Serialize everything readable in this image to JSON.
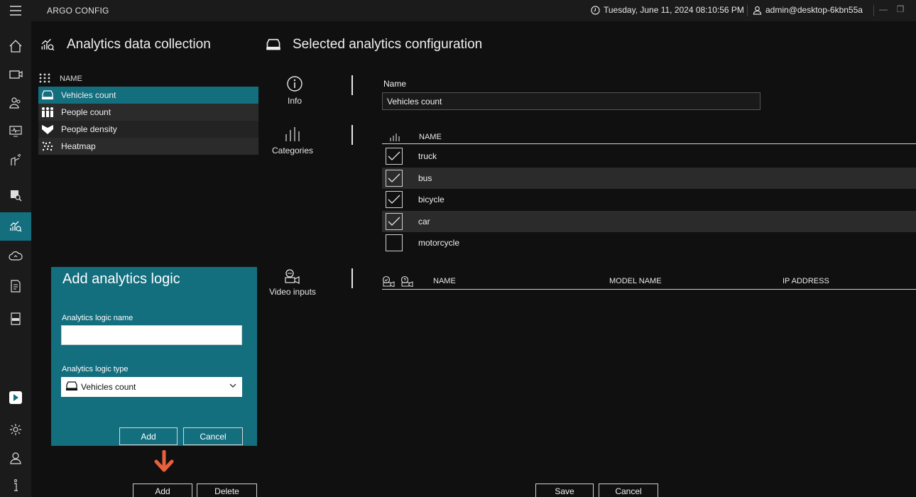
{
  "window": {
    "app_title": "ARGO CONFIG",
    "datetime": "Tuesday, June 11, 2024 08:10:56 PM",
    "user": "admin@desktop-6kbn55a",
    "minimize_glyph": "—",
    "restore_glyph": "❐"
  },
  "rail": {
    "items": [
      {
        "icon": "hamburger-menu-icon"
      },
      {
        "icon": "home-icon"
      },
      {
        "icon": "camera-config-icon"
      },
      {
        "icon": "users-icon"
      },
      {
        "icon": "monitor-icon"
      },
      {
        "icon": "sensor-icon"
      },
      {
        "icon": "search-person-icon"
      },
      {
        "icon": "analytics-icon",
        "active": true
      },
      {
        "icon": "cloud-sync-icon"
      },
      {
        "icon": "document-icon"
      },
      {
        "icon": "log-icon"
      },
      {
        "icon": "play-logo-icon"
      },
      {
        "icon": "settings-icon"
      },
      {
        "icon": "account-icon"
      },
      {
        "icon": "info-icon"
      }
    ]
  },
  "left_panel": {
    "title": "Analytics data collection",
    "column_name": "NAME",
    "items": [
      {
        "label": "Vehicles count",
        "icon": "vehicles-icon",
        "selected": true
      },
      {
        "label": "People count",
        "icon": "people-count-icon"
      },
      {
        "label": "People density",
        "icon": "people-density-icon"
      },
      {
        "label": "Heatmap",
        "icon": "heatmap-icon"
      }
    ],
    "add_button": "Add",
    "delete_button": "Delete"
  },
  "dialog": {
    "title": "Add analytics logic",
    "name_label": "Analytics logic name",
    "name_value": "",
    "type_label": "Analytics logic type",
    "type_value": "Vehicles count",
    "add_button": "Add",
    "cancel_button": "Cancel"
  },
  "right_panel": {
    "title": "Selected analytics configuration",
    "sections": {
      "info": "Info",
      "categories": "Categories",
      "video_inputs": "Video inputs"
    },
    "name_label": "Name",
    "name_value": "Vehicles count",
    "categories_column": "NAME",
    "categories": [
      {
        "label": "truck",
        "checked": true
      },
      {
        "label": "bus",
        "checked": true
      },
      {
        "label": "bicycle",
        "checked": true
      },
      {
        "label": "car",
        "checked": true
      },
      {
        "label": "motorcycle",
        "checked": false
      }
    ],
    "video_columns": {
      "name": "NAME",
      "model_name": "MODEL NAME",
      "ip_address": "IP ADDRESS"
    },
    "save_button": "Save",
    "cancel_button": "Cancel"
  },
  "colors": {
    "accent": "#136e7e",
    "pointer_arrow": "#e8603c"
  }
}
